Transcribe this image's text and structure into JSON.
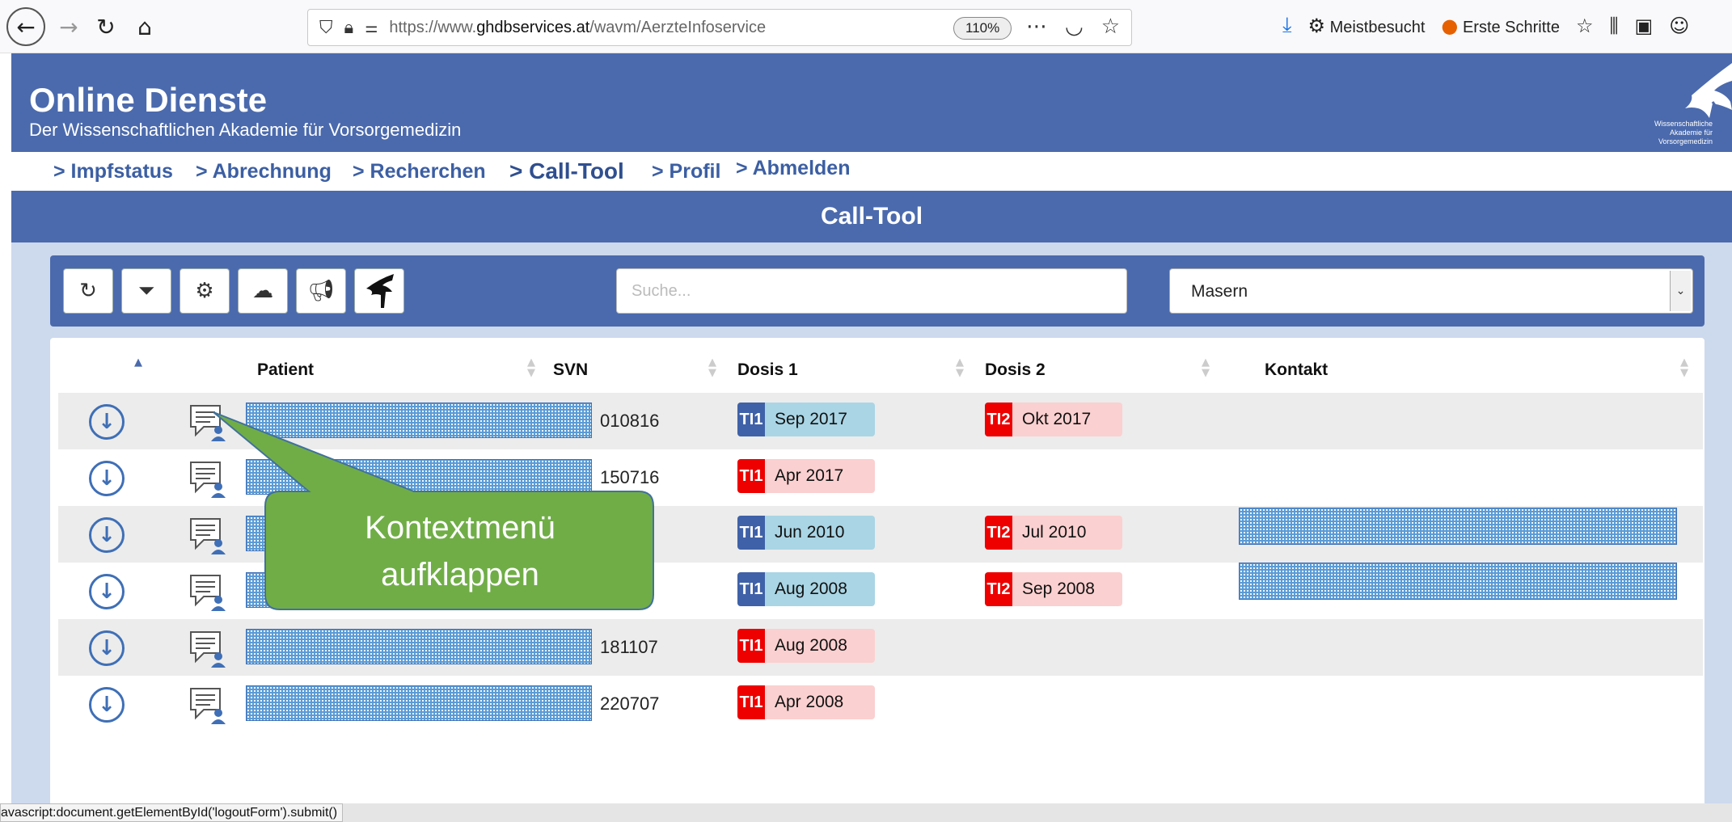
{
  "browser": {
    "url_prefix": "https://www.",
    "url_domain": "ghdbservices.at",
    "url_path": "/wavm/AerzteInfoservice",
    "zoom": "110%",
    "bookmarks": [
      "Meistbesucht",
      "Erste Schritte"
    ],
    "status_text": "avascript:document.getElementById('logoutForm').submit()"
  },
  "site": {
    "title": "Online Dienste",
    "subtitle": "Der Wissenschaftlichen Akademie für Vorsorgemedizin",
    "logo_text": [
      "Wissenschaftliche",
      "Akademie für",
      "Vorsorgemedizin"
    ]
  },
  "nav": [
    "> Impfstatus",
    "> Abrechnung",
    "> Recherchen",
    "> Call-Tool",
    "> Profil",
    "> Abmelden"
  ],
  "page_title": "Call-Tool",
  "toolbar": {
    "search_placeholder": "Suche...",
    "select_value": "Masern"
  },
  "table": {
    "headers": [
      "Patient",
      "SVN",
      "Dosis 1",
      "Dosis 2",
      "Kontakt"
    ],
    "rows": [
      {
        "svn": "010816",
        "d1_tag": "TI1",
        "d1_val": "Sep 2017",
        "d1_color": "blue",
        "d2_tag": "TI2",
        "d2_val": "Okt 2017"
      },
      {
        "svn": "150716",
        "d1_tag": "TI1",
        "d1_val": "Apr 2017",
        "d1_color": "red"
      },
      {
        "svn": "",
        "d1_tag": "TI1",
        "d1_val": "Jun 2010",
        "d1_color": "blue",
        "d2_tag": "TI2",
        "d2_val": "Jul 2010"
      },
      {
        "svn": "",
        "d1_tag": "TI1",
        "d1_val": "Aug 2008",
        "d1_color": "blue",
        "d2_tag": "TI2",
        "d2_val": "Sep 2008"
      },
      {
        "svn": "181107",
        "d1_tag": "TI1",
        "d1_val": "Aug 2008",
        "d1_color": "red"
      },
      {
        "svn": "220707",
        "d1_tag": "TI1",
        "d1_val": "Apr 2008",
        "d1_color": "red"
      }
    ]
  },
  "callout": {
    "line1": "Kontextmenü",
    "line2": "aufklappen"
  },
  "colors": {
    "header_blue": "#4b6aad",
    "callout_green": "#70ad47",
    "badge_red": "#ee0000"
  }
}
